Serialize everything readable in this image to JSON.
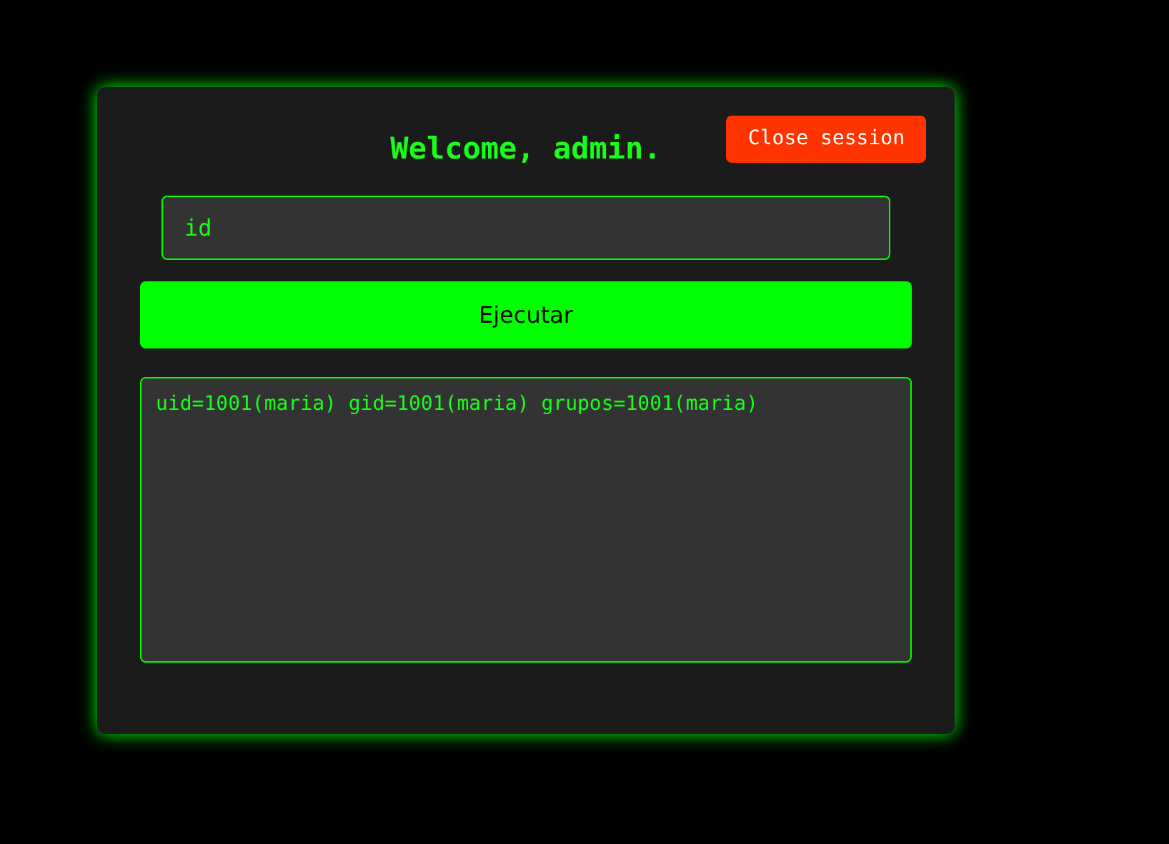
{
  "panel": {
    "title": "Welcome, admin.",
    "close_button": "Close session"
  },
  "command": {
    "value": "id"
  },
  "run_button": "Ejecutar",
  "output": {
    "value": "uid=1001(maria) gid=1001(maria) grupos=1001(maria)"
  }
}
